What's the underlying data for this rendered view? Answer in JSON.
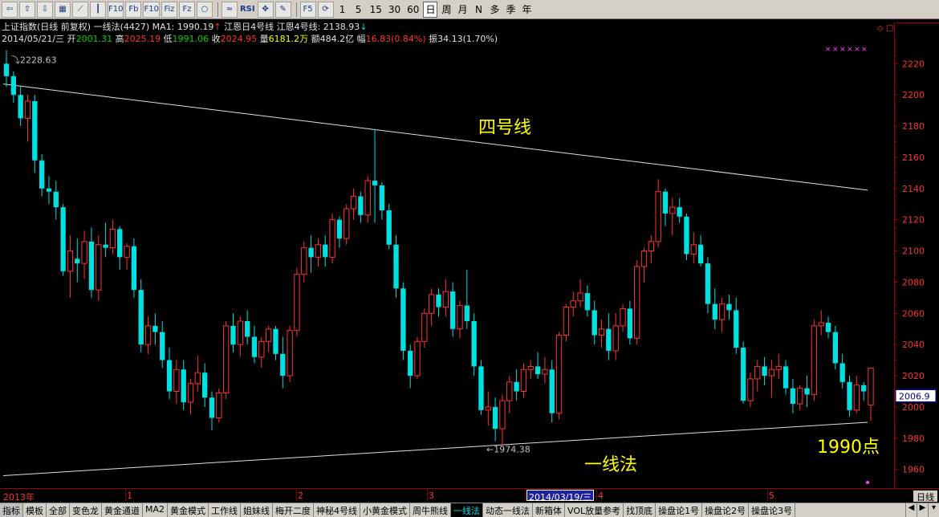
{
  "toolbar": {
    "icons": [
      {
        "name": "back-icon",
        "glyph": "⇦"
      },
      {
        "name": "up-icon",
        "glyph": "⇧"
      },
      {
        "name": "down-icon",
        "glyph": "⇩"
      },
      {
        "name": "table-icon",
        "glyph": "▦"
      },
      {
        "name": "line-chart-icon",
        "glyph": "⟋"
      },
      {
        "name": "kline-icon",
        "glyph": "┃"
      },
      {
        "name": "f10-icon",
        "glyph": "F10"
      },
      {
        "name": "fenshi-icon",
        "glyph": "Fb"
      },
      {
        "name": "f10b-icon",
        "glyph": "F10"
      },
      {
        "name": "fiz-icon",
        "glyph": "Fiz"
      },
      {
        "name": "fz-icon",
        "glyph": "Fz"
      },
      {
        "name": "circle-icon",
        "glyph": "○"
      }
    ],
    "tool_icons": [
      {
        "name": "wave-icon",
        "glyph": "≈"
      },
      {
        "name": "rsi-icon",
        "glyph": "RSI"
      },
      {
        "name": "move-icon",
        "glyph": "✥"
      },
      {
        "name": "pencil-icon",
        "glyph": "✎"
      }
    ],
    "period_icons": [
      {
        "name": "f5-icon",
        "glyph": "F5"
      },
      {
        "name": "refresh-icon",
        "glyph": "⟳"
      }
    ],
    "periods": [
      "1",
      "5",
      "15",
      "30",
      "60",
      "日",
      "周",
      "月",
      "N",
      "多",
      "季",
      "年"
    ],
    "selected_period": "日"
  },
  "info_line1": {
    "index_name": "上证指数(日线 前复权)",
    "method": "一线法(4427)",
    "ma_label": "MA1: 1990.19",
    "ma_arrow": "↑",
    "jiang1": "江恩日4号线",
    "jiang2": "江恩4号线: 2138.93",
    "jiang2_arrow": "↓"
  },
  "info_line2": {
    "date": "2014/05/21/三",
    "open_label": "开",
    "open_value": "2001.31",
    "high_label": "高",
    "high_value": "2025.19",
    "low_label": "低",
    "low_value": "1991.06",
    "close_label": "收",
    "close_value": "2024.95",
    "vol_label": "量",
    "vol_value": "6181.2万",
    "amount_label": "额",
    "amount_value": "484.2亿",
    "chg_label": "幅",
    "chg_value": "16.83(0.84%)",
    "amp_label": "振",
    "amp_value": "34.13(1.70%)"
  },
  "colors": {
    "up": "#ff3232",
    "down": "#00e0e0",
    "axis_text": "#ff3232",
    "annotation": "#ffff00",
    "line": "#e0e0e0",
    "marker": "#ff40ff"
  },
  "chart_data": {
    "type": "candlestick",
    "title": "",
    "ylim": [
      1948,
      2232
    ],
    "y_ticks": [
      1960,
      1980,
      2000,
      2020,
      2040,
      2060,
      2080,
      2100,
      2120,
      2140,
      2160,
      2180,
      2200,
      2220
    ],
    "current_price_label": "2006.9",
    "high_marker_label": "2228.63",
    "low_marker_label": "1974.38",
    "annotations": {
      "line4_label": "四号线",
      "line1_label": "一线法",
      "target_label": "1990点"
    },
    "x_date_labels": [
      "2013年",
      "1",
      "2",
      "3",
      "2014/03/19/三",
      "4",
      "5"
    ],
    "period_label": "日线",
    "line4": {
      "start": 2207,
      "end": 2138.93
    },
    "line1": {
      "start": 1956,
      "end": 1990.19
    },
    "candles": [
      [
        2220,
        2228.63,
        2205,
        2212
      ],
      [
        2212,
        2215,
        2195,
        2200
      ],
      [
        2200,
        2206,
        2180,
        2185
      ],
      [
        2185,
        2200,
        2170,
        2196
      ],
      [
        2196,
        2200,
        2150,
        2158
      ],
      [
        2158,
        2162,
        2135,
        2140
      ],
      [
        2140,
        2148,
        2130,
        2138
      ],
      [
        2138,
        2145,
        2120,
        2128
      ],
      [
        2128,
        2130,
        2084,
        2087
      ],
      [
        2087,
        2110,
        2070,
        2100
      ],
      [
        2095,
        2108,
        2080,
        2092
      ],
      [
        2092,
        2113,
        2082,
        2106
      ],
      [
        2106,
        2115,
        2070,
        2075
      ],
      [
        2075,
        2110,
        2068,
        2104
      ],
      [
        2104,
        2118,
        2096,
        2102
      ],
      [
        2102,
        2120,
        2098,
        2114
      ],
      [
        2114,
        2116,
        2088,
        2096
      ],
      [
        2096,
        2105,
        2088,
        2103
      ],
      [
        2103,
        2108,
        2070,
        2075
      ],
      [
        2075,
        2082,
        2035,
        2040
      ],
      [
        2040,
        2058,
        2034,
        2052
      ],
      [
        2052,
        2060,
        2040,
        2048
      ],
      [
        2048,
        2055,
        2025,
        2030
      ],
      [
        2030,
        2038,
        2005,
        2010
      ],
      [
        2010,
        2030,
        2002,
        2024
      ],
      [
        2024,
        2030,
        1998,
        2003
      ],
      [
        2003,
        2018,
        1995,
        2015
      ],
      [
        2015,
        2033,
        2010,
        2022
      ],
      [
        2022,
        2028,
        2000,
        2006
      ],
      [
        2006,
        2010,
        1985,
        1993
      ],
      [
        1993,
        2012,
        1990,
        2009
      ],
      [
        2009,
        2055,
        2005,
        2052
      ],
      [
        2052,
        2060,
        2035,
        2040
      ],
      [
        2040,
        2058,
        2032,
        2055
      ],
      [
        2055,
        2062,
        2040,
        2045
      ],
      [
        2045,
        2052,
        2028,
        2032
      ],
      [
        2032,
        2045,
        2025,
        2042
      ],
      [
        2042,
        2052,
        2035,
        2050
      ],
      [
        2050,
        2052,
        2030,
        2034
      ],
      [
        2034,
        2045,
        2012,
        2020
      ],
      [
        2020,
        2052,
        2016,
        2049
      ],
      [
        2049,
        2089,
        2045,
        2085
      ],
      [
        2085,
        2106,
        2080,
        2102
      ],
      [
        2102,
        2110,
        2086,
        2096
      ],
      [
        2096,
        2108,
        2090,
        2104
      ],
      [
        2104,
        2110,
        2090,
        2096
      ],
      [
        2096,
        2124,
        2092,
        2120
      ],
      [
        2120,
        2122,
        2102,
        2108
      ],
      [
        2108,
        2130,
        2104,
        2127
      ],
      [
        2127,
        2140,
        2120,
        2135
      ],
      [
        2135,
        2138,
        2118,
        2123
      ],
      [
        2123,
        2148,
        2118,
        2145
      ],
      [
        2145,
        2178,
        2118,
        2142
      ],
      [
        2142,
        2144,
        2120,
        2126
      ],
      [
        2126,
        2130,
        2101,
        2104
      ],
      [
        2104,
        2110,
        2070,
        2076
      ],
      [
        2076,
        2080,
        2030,
        2036
      ],
      [
        2036,
        2040,
        2012,
        2020
      ],
      [
        2020,
        2045,
        2018,
        2042
      ],
      [
        2042,
        2063,
        2038,
        2060
      ],
      [
        2060,
        2076,
        2052,
        2072
      ],
      [
        2072,
        2076,
        2058,
        2064
      ],
      [
        2064,
        2082,
        2058,
        2074
      ],
      [
        2074,
        2080,
        2045,
        2050
      ],
      [
        2050,
        2068,
        2044,
        2065
      ],
      [
        2065,
        2088,
        2050,
        2055
      ],
      [
        2055,
        2060,
        2020,
        2026
      ],
      [
        2026,
        2030,
        1995,
        1998
      ],
      [
        1998,
        2010,
        1988,
        2000
      ],
      [
        2000,
        2006,
        1978,
        1986
      ],
      [
        1986,
        2008,
        1974.38,
        2004
      ],
      [
        2004,
        2020,
        1996,
        2016
      ],
      [
        2016,
        2024,
        2004,
        2010
      ],
      [
        2010,
        2028,
        2006,
        2024
      ],
      [
        2024,
        2030,
        2018,
        2026
      ],
      [
        2026,
        2035,
        2018,
        2021
      ],
      [
        2021,
        2032,
        2015,
        2024
      ],
      [
        2024,
        2030,
        1990,
        1996
      ],
      [
        1996,
        2048,
        1992,
        2046
      ],
      [
        2046,
        2066,
        2042,
        2064
      ],
      [
        2064,
        2074,
        2058,
        2068
      ],
      [
        2068,
        2082,
        2064,
        2073
      ],
      [
        2073,
        2078,
        2058,
        2062
      ],
      [
        2062,
        2068,
        2040,
        2046
      ],
      [
        2046,
        2056,
        2038,
        2050
      ],
      [
        2050,
        2060,
        2030,
        2036
      ],
      [
        2036,
        2060,
        2030,
        2052
      ],
      [
        2052,
        2066,
        2048,
        2063
      ],
      [
        2063,
        2068,
        2040,
        2044
      ],
      [
        2044,
        2094,
        2040,
        2090
      ],
      [
        2090,
        2102,
        2080,
        2100
      ],
      [
        2100,
        2110,
        2092,
        2106
      ],
      [
        2106,
        2146,
        2102,
        2138
      ],
      [
        2138,
        2140,
        2116,
        2124
      ],
      [
        2124,
        2134,
        2110,
        2128
      ],
      [
        2128,
        2134,
        2118,
        2122
      ],
      [
        2122,
        2124,
        2094,
        2098
      ],
      [
        2098,
        2112,
        2092,
        2104
      ],
      [
        2104,
        2110,
        2090,
        2092
      ],
      [
        2092,
        2096,
        2060,
        2066
      ],
      [
        2066,
        2076,
        2050,
        2056
      ],
      [
        2056,
        2070,
        2048,
        2066
      ],
      [
        2066,
        2072,
        2056,
        2062
      ],
      [
        2062,
        2070,
        2034,
        2038
      ],
      [
        2038,
        2042,
        2002,
        2004
      ],
      [
        2004,
        2022,
        2000,
        2018
      ],
      [
        2018,
        2030,
        2010,
        2026
      ],
      [
        2026,
        2032,
        2014,
        2020
      ],
      [
        2020,
        2030,
        2006,
        2024
      ],
      [
        2024,
        2034,
        2018,
        2026
      ],
      [
        2026,
        2030,
        2008,
        2012
      ],
      [
        2012,
        2018,
        1996,
        2002
      ],
      [
        2002,
        2014,
        1998,
        2012
      ],
      [
        2012,
        2020,
        2000,
        2008
      ],
      [
        2008,
        2056,
        2004,
        2052
      ],
      [
        2052,
        2062,
        2046,
        2054
      ],
      [
        2054,
        2058,
        2044,
        2048
      ],
      [
        2048,
        2052,
        2024,
        2028
      ],
      [
        2028,
        2034,
        2012,
        2016
      ],
      [
        2016,
        2020,
        1994,
        1998
      ],
      [
        1998,
        2020,
        1996,
        2014
      ],
      [
        2014,
        2016,
        2004,
        2010
      ],
      [
        2001.31,
        2025.19,
        1991.06,
        2024.95
      ]
    ]
  },
  "bottom_tabs": [
    "指标",
    "模板",
    "全部",
    "变色龙",
    "黄金通道",
    "MA2",
    "黄金模式",
    "工作线",
    "姐妹线",
    "梅开二度",
    "神秘4号线",
    "小黄金模式",
    "周牛熊线",
    "一线法",
    "动态一线法",
    "新箱体",
    "VOL放量参考",
    "找顶底",
    "操盘论1号",
    "操盘论2号",
    "操盘论3号"
  ],
  "active_tab": "一线法",
  "nav_buttons": [
    {
      "name": "tab-prev-icon",
      "glyph": "◀"
    },
    {
      "name": "tab-next-icon",
      "glyph": "▶"
    },
    {
      "name": "tab-menu-icon",
      "glyph": "▾"
    }
  ]
}
